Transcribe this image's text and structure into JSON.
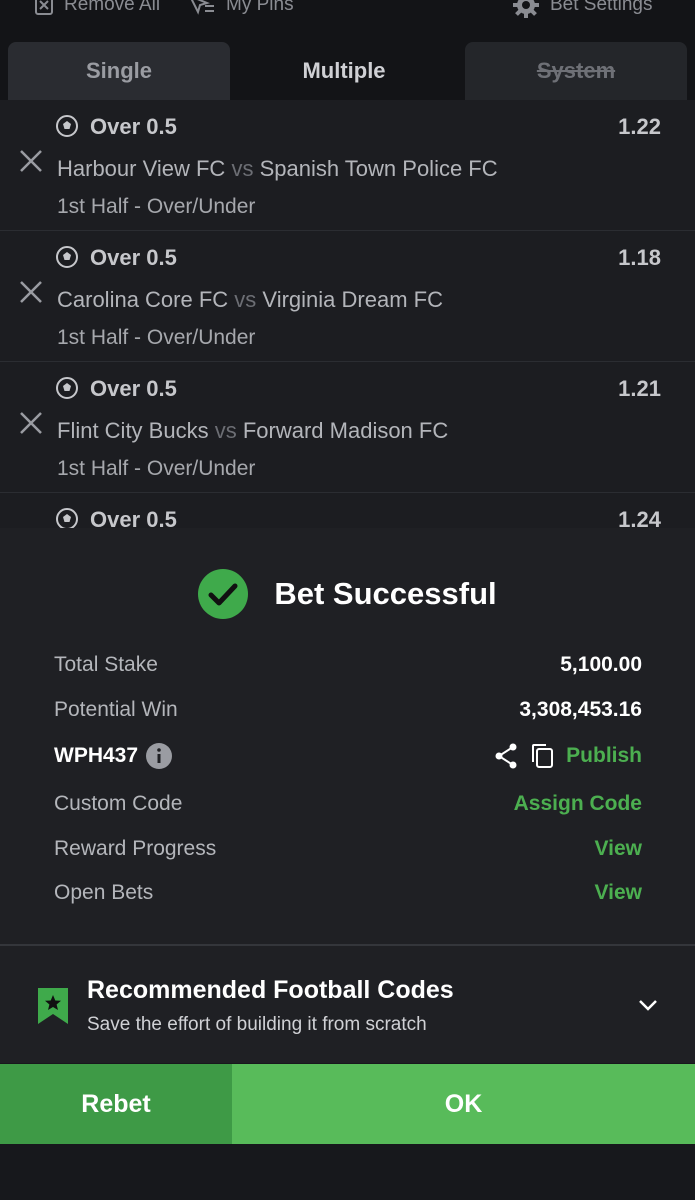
{
  "topbar": {
    "remove_all": "Remove All",
    "my_pins": "My Pins",
    "bet_settings": "Bet Settings"
  },
  "tabs": [
    {
      "label": "Single",
      "state": "inactive"
    },
    {
      "label": "Multiple",
      "state": "active"
    },
    {
      "label": "System",
      "state": "disabled"
    }
  ],
  "bets": [
    {
      "selection": "Over 0.5",
      "odds": "1.22",
      "home": "Harbour View FC",
      "vs": "vs",
      "away": "Spanish Town Police FC",
      "market": "1st Half - Over/Under"
    },
    {
      "selection": "Over 0.5",
      "odds": "1.18",
      "home": "Carolina Core FC",
      "vs": "vs",
      "away": "Virginia Dream FC",
      "market": "1st Half - Over/Under"
    },
    {
      "selection": "Over 0.5",
      "odds": "1.21",
      "home": "Flint City Bucks",
      "vs": "vs",
      "away": "Forward Madison FC",
      "market": "1st Half - Over/Under"
    },
    {
      "selection": "Over 0.5",
      "odds": "1.24",
      "home": "",
      "vs": "",
      "away": "",
      "market": ""
    }
  ],
  "result": {
    "title": "Bet Successful",
    "total_stake_label": "Total Stake",
    "total_stake_value": "5,100.00",
    "potential_win_label": "Potential Win",
    "potential_win_value": "3,308,453.16",
    "booking_code": "WPH437",
    "publish_label": "Publish",
    "custom_code_label": "Custom Code",
    "assign_code_label": "Assign Code",
    "reward_progress_label": "Reward Progress",
    "reward_view_label": "View",
    "open_bets_label": "Open Bets",
    "open_bets_view_label": "View"
  },
  "recommended": {
    "title": "Recommended Football Codes",
    "subtitle": "Save the effort of building it from scratch"
  },
  "actions": {
    "rebet_label": "Rebet",
    "ok_label": "OK"
  },
  "colors": {
    "accent_green": "#4caf50",
    "ok_button": "#58bb5a",
    "rebet_button": "#3e9a46",
    "background": "#17181c"
  }
}
